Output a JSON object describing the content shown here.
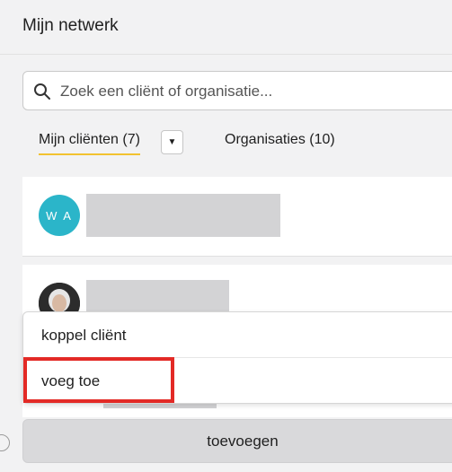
{
  "header": {
    "title": "Mijn netwerk"
  },
  "search": {
    "placeholder": "Zoek een cliënt of organisatie..."
  },
  "tabs": [
    {
      "label": "Mijn cliënten (7)",
      "active": true
    },
    {
      "label": "Organisaties (10)",
      "active": false
    }
  ],
  "clients": [
    {
      "initials": "W A"
    },
    {
      "initials": ""
    }
  ],
  "dropdown_menu": {
    "items": [
      {
        "label": "koppel cliënt"
      },
      {
        "label": "voeg toe"
      }
    ]
  },
  "footer": {
    "add_label": "toevoegen"
  },
  "colors": {
    "accent": "#f2c230",
    "avatar": "#2bb5c9",
    "highlight": "#e32a26"
  }
}
